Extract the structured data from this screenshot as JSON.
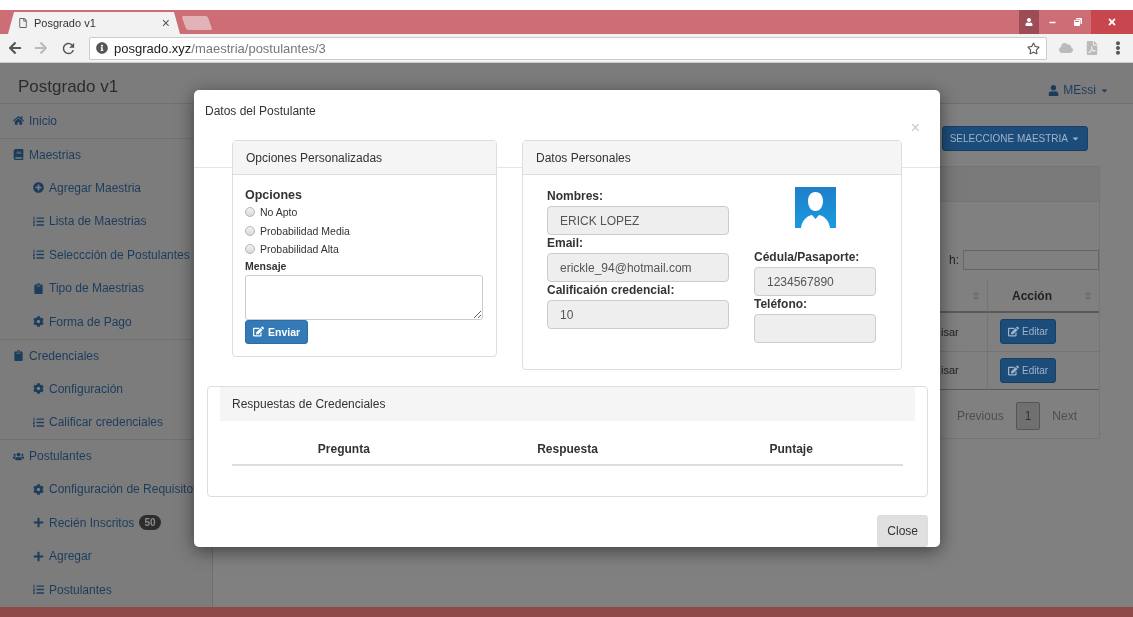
{
  "browser": {
    "tab_title": "Posgrado v1",
    "tab_close": "×",
    "url_host": "posgrado.xyz",
    "url_path": "/maestria/postulantes/3"
  },
  "navbar": {
    "brand": "Postgrado v1",
    "user": "MEssi"
  },
  "sidebar": {
    "items": [
      {
        "label": "Inicio"
      },
      {
        "label": "Maestrias",
        "children": [
          {
            "label": "Agregar Maestria"
          },
          {
            "label": "Lista de Maestrias"
          },
          {
            "label": "Seleccción de Postulantes"
          },
          {
            "label": "Tipo de Maestrias"
          },
          {
            "label": "Forma de Pago"
          }
        ]
      },
      {
        "label": "Credenciales",
        "children": [
          {
            "label": "Configuración"
          },
          {
            "label": "Calificar credenciales"
          }
        ]
      },
      {
        "label": "Postulantes",
        "children": [
          {
            "label": "Configuración de Requisito"
          },
          {
            "label": "Recién Inscritos",
            "badge": "50"
          },
          {
            "label": "Agregar"
          },
          {
            "label": "Postulantes"
          }
        ]
      }
    ]
  },
  "main": {
    "select_button": "SELECCIONE MAESTRIA",
    "search_label": "h:",
    "table": {
      "columns": [
        {
          "label": "Acción"
        }
      ],
      "rows": [
        {
          "column_1": "isar",
          "action": "Editar"
        },
        {
          "column_1": "isar",
          "action": "Editar"
        }
      ]
    },
    "pagination": {
      "previous": "Previous",
      "pages": [
        {
          "label": "1",
          "selected": true
        }
      ],
      "next": "Next"
    }
  },
  "modal": {
    "title": "Datos del Postulante",
    "close": "×",
    "options_panel": {
      "heading": "Opciones Personalizadas",
      "options_label": "Opciones",
      "options": [
        {
          "label": "No Apto",
          "selected": false
        },
        {
          "label": "Probabilidad Media",
          "selected": false
        },
        {
          "label": "Probabilidad Alta",
          "selected": false
        }
      ],
      "message_label": "Mensaje",
      "send_button": "Enviar"
    },
    "personal_panel": {
      "heading": "Datos Personales",
      "left_fields": [
        {
          "label": "Nombres:",
          "value": "ERICK LOPEZ"
        },
        {
          "label": "Email:",
          "value": "erickle_94@hotmail.com"
        },
        {
          "label": "Calificaión credencial:",
          "value": "10"
        }
      ],
      "right_fields": [
        {
          "label": "Cédula/Pasaporte:",
          "value": "1234567890"
        },
        {
          "label": "Teléfono:"
        }
      ]
    },
    "credentials_panel": {
      "heading": "Respuestas de Credenciales",
      "columns": [
        "Pregunta",
        "Respuesta",
        "Puntaje"
      ]
    },
    "close_button": "Close"
  }
}
